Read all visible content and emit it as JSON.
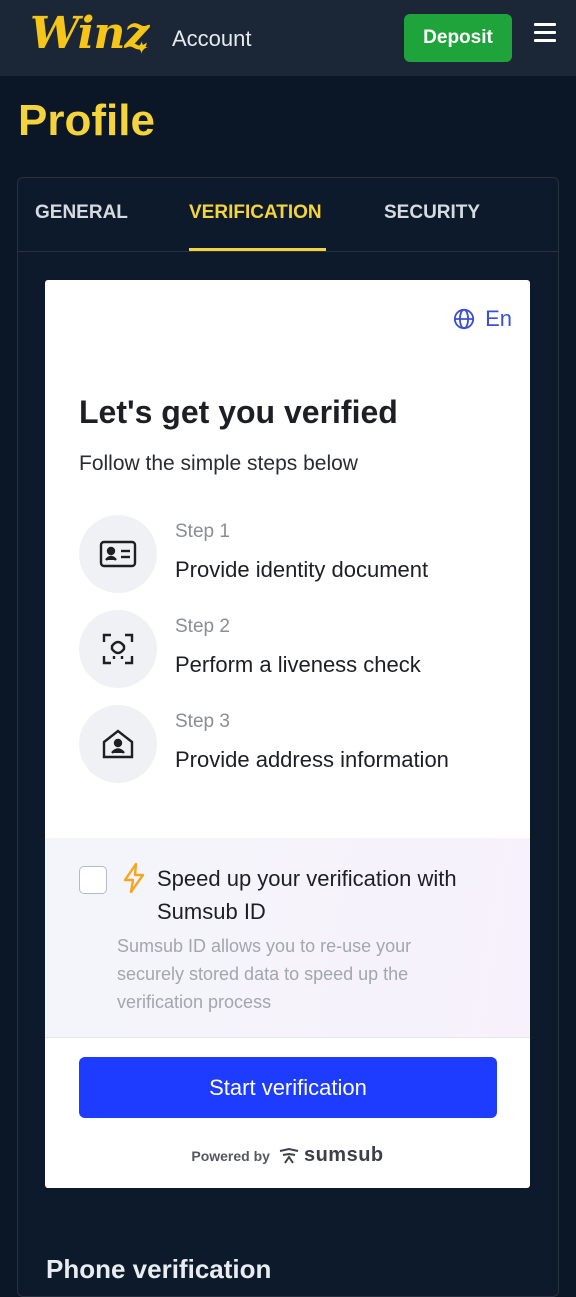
{
  "header": {
    "logo_text": "Winz",
    "title": "Account",
    "deposit_label": "Deposit"
  },
  "page": {
    "title": "Profile"
  },
  "tabs": [
    {
      "label": "GENERAL",
      "active": false
    },
    {
      "label": "VERIFICATION",
      "active": true
    },
    {
      "label": "SECURITY",
      "active": false
    }
  ],
  "verification": {
    "language": "En",
    "title": "Let's get you verified",
    "subtitle": "Follow the simple steps below",
    "steps": [
      {
        "number": "Step 1",
        "text": "Provide identity document",
        "icon": "id-card-icon"
      },
      {
        "number": "Step 2",
        "text": "Perform a liveness check",
        "icon": "face-scan-icon"
      },
      {
        "number": "Step 3",
        "text": "Provide address information",
        "icon": "home-user-icon"
      }
    ],
    "speedup": {
      "title": "Speed up your verification with Sumsub ID",
      "description": "Sumsub ID allows you to re-use your securely stored data to speed up the verification process",
      "checked": false
    },
    "start_label": "Start verification",
    "powered_by": "Powered by",
    "provider": "sumsub"
  },
  "phone_section": {
    "title": "Phone verification"
  },
  "colors": {
    "accent_yellow": "#f5d33a",
    "deposit_green": "#1fa33b",
    "primary_blue": "#1d3cff",
    "background": "#0b1727"
  }
}
